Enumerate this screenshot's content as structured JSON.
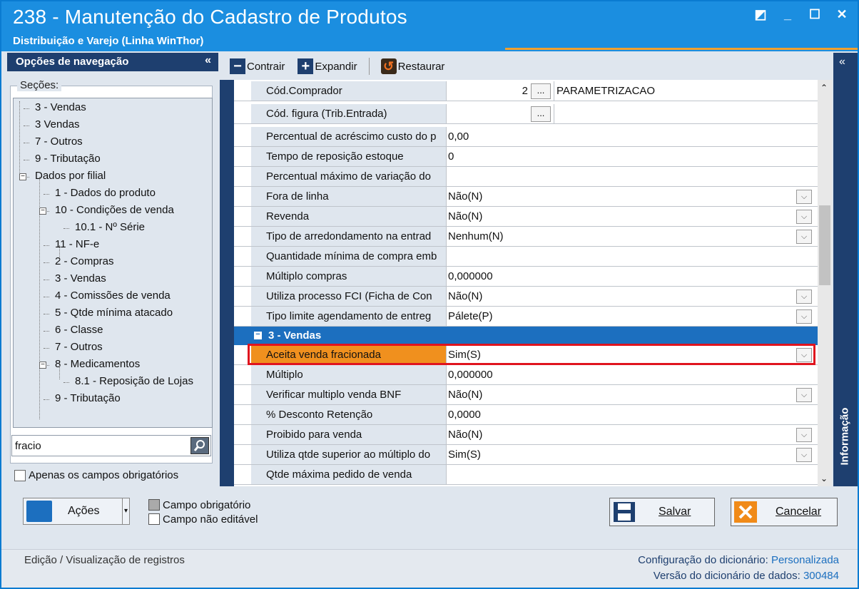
{
  "window": {
    "title": "238 - Manutenção do Cadastro de Produtos",
    "subtitle": "Distribuição e Varejo (Linha WinThor)",
    "controls": [
      "◩",
      "_",
      "☐",
      "✕"
    ]
  },
  "nav": {
    "header": "Opções de navegação",
    "collapse_icon": "«",
    "sections_label": "Seções:",
    "tree": [
      {
        "label": "3 - Vendas",
        "level": 0
      },
      {
        "label": "3 Vendas",
        "level": 0
      },
      {
        "label": "7 - Outros",
        "level": 0
      },
      {
        "label": "9 - Tributação",
        "level": 0
      },
      {
        "label": "Dados por filial",
        "level": 0,
        "expander": "−"
      },
      {
        "label": "1 - Dados do produto",
        "level": 1
      },
      {
        "label": "10 - Condições de venda",
        "level": 1,
        "expander": "−"
      },
      {
        "label": "10.1 - Nº Série",
        "level": 2
      },
      {
        "label": "11 - NF-e",
        "level": 1
      },
      {
        "label": "2 - Compras",
        "level": 1
      },
      {
        "label": "3 - Vendas",
        "level": 1
      },
      {
        "label": "4 - Comissões de venda",
        "level": 1
      },
      {
        "label": "5 - Qtde mínima atacado",
        "level": 1
      },
      {
        "label": "6 - Classe",
        "level": 1
      },
      {
        "label": "7 - Outros",
        "level": 1
      },
      {
        "label": "8 - Medicamentos",
        "level": 1,
        "expander": "−"
      },
      {
        "label": "8.1 -  Reposição de Lojas",
        "level": 2
      },
      {
        "label": "9 - Tributação",
        "level": 1
      }
    ],
    "search_value": "fracio",
    "only_required_label": "Apenas os campos obrigatórios"
  },
  "toolbar": {
    "contrair": "Contrair",
    "expandir": "Expandir",
    "restaurar": "Restaurar"
  },
  "grid": {
    "rows": [
      {
        "label": "Cód.Comprador",
        "value": "2",
        "extra": "PARAMETRIZACAO",
        "type": "lookup"
      },
      {
        "label": "Cód. figura (Trib.Entrada)",
        "value": "",
        "type": "lookup"
      },
      {
        "label": "Percentual de acréscimo custo do p",
        "value": "0,00",
        "type": "text"
      },
      {
        "label": "Tempo de reposição estoque",
        "value": "0",
        "type": "text"
      },
      {
        "label": "Percentual máximo de variação do",
        "value": "",
        "type": "text"
      },
      {
        "label": "Fora de linha",
        "value": "Não(N)",
        "type": "dropdown"
      },
      {
        "label": "Revenda",
        "value": "Não(N)",
        "type": "dropdown"
      },
      {
        "label": "Tipo de arredondamento na entrad",
        "value": "Nenhum(N)",
        "type": "dropdown"
      },
      {
        "label": "Quantidade mínima de compra emb",
        "value": "",
        "type": "text"
      },
      {
        "label": "Múltiplo compras",
        "value": "0,000000",
        "type": "text"
      },
      {
        "label": "Utiliza processo FCI (Ficha de Con",
        "value": "Não(N)",
        "type": "dropdown"
      },
      {
        "label": "Tipo limite agendamento de entreg",
        "value": "Pálete(P)",
        "type": "dropdown"
      }
    ],
    "section": {
      "label": "3 - Vendas",
      "expander": "−"
    },
    "section_rows": [
      {
        "label": "Aceita venda fracionada",
        "value": "Sim(S)",
        "type": "dropdown"
      },
      {
        "label": "Múltiplo",
        "value": "0,000000",
        "type": "text"
      },
      {
        "label": "Verificar multiplo venda BNF",
        "value": "Não(N)",
        "type": "dropdown"
      },
      {
        "label": "% Desconto Retenção",
        "value": "0,0000",
        "type": "text"
      },
      {
        "label": "Proibido para venda",
        "value": "Não(N)",
        "type": "dropdown"
      },
      {
        "label": "Utiliza qtde superior ao múltiplo do",
        "value": "Sim(S)",
        "type": "dropdown"
      },
      {
        "label": "Qtde máxima pedido de venda",
        "value": "",
        "type": "text"
      }
    ],
    "ellipsis": "...",
    "dropdown_glyph": "⌵"
  },
  "right_panel": {
    "collapse_icon": "«",
    "info_label": "Informação"
  },
  "bottom": {
    "acoes": "Ações",
    "legend_required": "Campo obrigatório",
    "legend_noneditable": "Campo não editável",
    "salvar": "Salvar",
    "cancelar": "Cancelar"
  },
  "status": {
    "left": "Edição / Visualização de registros",
    "dict_config_label": "Configuração do dicionário:",
    "dict_config_value": "Personalizada",
    "dict_version_label": "Versão do dicionário de dados:",
    "dict_version_value": "300484"
  },
  "colors": {
    "accent": "#1c6fbf",
    "title_bar": "#1b8ee0",
    "nav_dark": "#1e3f6f",
    "highlight_label": "#f0901e",
    "highlight_border": "#e0141e"
  }
}
